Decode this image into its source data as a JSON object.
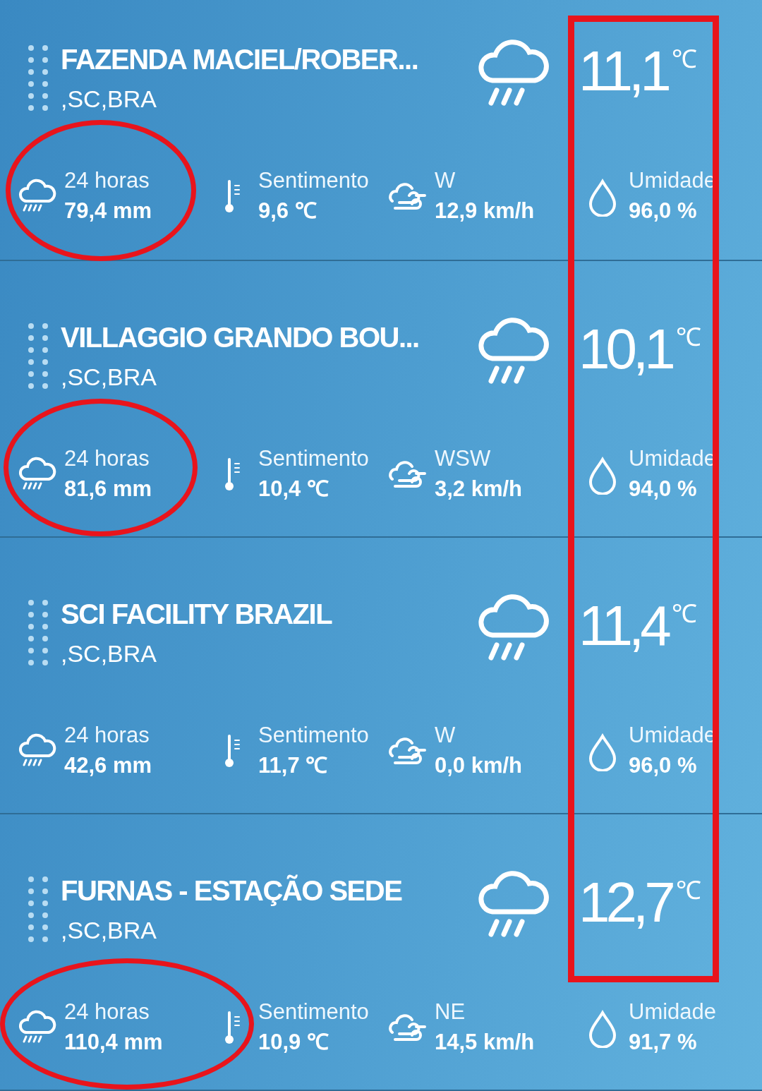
{
  "stations": [
    {
      "name": "FAZENDA MACIEL/ROBER...",
      "region": ",SC,BRA",
      "temperature": "11,1",
      "unit": "℃",
      "circled": true,
      "stats": [
        {
          "kind": "rain",
          "label": "24 horas",
          "value": "79,4 mm"
        },
        {
          "kind": "feel",
          "label": "Sentimento",
          "value": "9,6 ℃"
        },
        {
          "kind": "wind",
          "label": "W",
          "value": "12,9 km/h"
        },
        {
          "kind": "humidity",
          "label": "Umidade",
          "value": "96,0 %"
        }
      ]
    },
    {
      "name": "VILLAGGIO GRANDO BOU...",
      "region": ",SC,BRA",
      "temperature": "10,1",
      "unit": "℃",
      "circled": true,
      "stats": [
        {
          "kind": "rain",
          "label": "24 horas",
          "value": "81,6 mm"
        },
        {
          "kind": "feel",
          "label": "Sentimento",
          "value": "10,4 ℃"
        },
        {
          "kind": "wind",
          "label": "WSW",
          "value": "3,2 km/h"
        },
        {
          "kind": "humidity",
          "label": "Umidade",
          "value": "94,0 %"
        }
      ]
    },
    {
      "name": "SCI FACILITY BRAZIL",
      "region": ",SC,BRA",
      "temperature": "11,4",
      "unit": "℃",
      "circled": false,
      "stats": [
        {
          "kind": "rain",
          "label": "24 horas",
          "value": "42,6 mm"
        },
        {
          "kind": "feel",
          "label": "Sentimento",
          "value": "11,7 ℃"
        },
        {
          "kind": "wind",
          "label": "W",
          "value": "0,0 km/h"
        },
        {
          "kind": "humidity",
          "label": "Umidade",
          "value": "96,0 %"
        }
      ]
    },
    {
      "name": "FURNAS - ESTAÇÃO SEDE",
      "region": ",SC,BRA",
      "temperature": "12,7",
      "unit": "℃",
      "circled": true,
      "stats": [
        {
          "kind": "rain",
          "label": "24 horas",
          "value": "110,4 mm"
        },
        {
          "kind": "feel",
          "label": "Sentimento",
          "value": "10,9 ℃"
        },
        {
          "kind": "wind",
          "label": "NE",
          "value": "14,5 km/h"
        },
        {
          "kind": "humidity",
          "label": "Umidade",
          "value": "91,7 %"
        }
      ]
    }
  ],
  "temperature_frame": true
}
